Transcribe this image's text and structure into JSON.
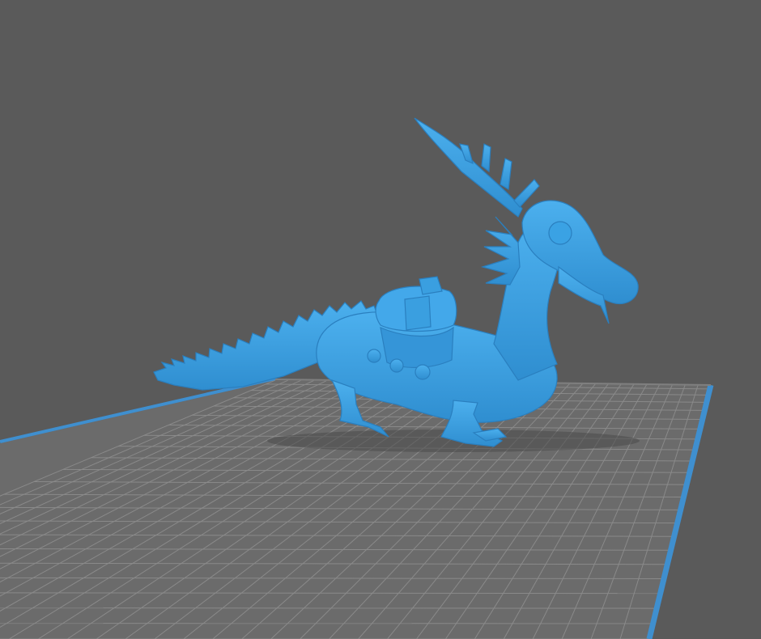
{
  "viewport": {
    "background_color": "#5a5a5a",
    "build_plate_color": "#6b6b6b",
    "grid_line_color": "#8a8a8a",
    "plate_edge_color": "#3f8fcf",
    "model_color": "#3a9fe0",
    "model_shadow_color": "#4a4a4a"
  },
  "model": {
    "type": "dragon-figurine",
    "parts": [
      "head",
      "antlers",
      "neck-spikes",
      "body",
      "saddle-bag",
      "tail-spikes",
      "legs"
    ]
  }
}
